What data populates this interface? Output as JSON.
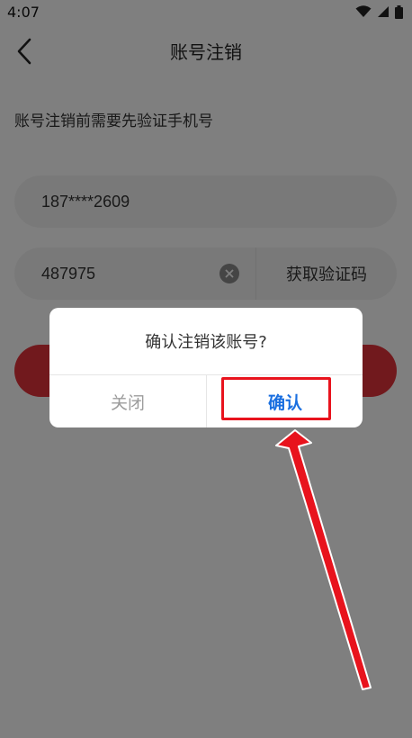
{
  "status_bar": {
    "time": "4:07"
  },
  "header": {
    "title": "账号注销"
  },
  "form": {
    "hint": "账号注销前需要先验证手机号",
    "phone_value": "187****2609",
    "code_value": "487975",
    "get_code_label": "获取验证码"
  },
  "dialog": {
    "message": "确认注销该账号?",
    "close_label": "关闭",
    "confirm_label": "确认"
  },
  "colors": {
    "accent_red": "#e3333a",
    "confirm_blue": "#1a6fe0",
    "highlight_red": "#e8131d"
  }
}
